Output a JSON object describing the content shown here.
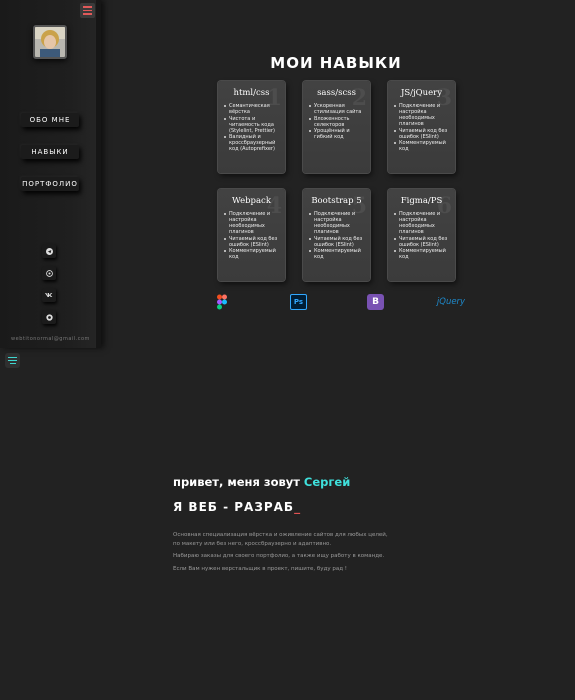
{
  "sidebar": {
    "nav": [
      "ОБО МНЕ",
      "НАВЫКИ",
      "ПОРТФОЛИО"
    ],
    "social_icons": [
      "telegram-icon",
      "whatsapp-icon",
      "vk-icon",
      "github-icon"
    ],
    "email": "webtitonormal@gmail.com"
  },
  "skills": {
    "title": "МОИ НАВЫКИ",
    "cards": [
      {
        "title": "html/css",
        "num": "1",
        "items": [
          "Семантическая вёрстка",
          "Чистота и читаемость кода (Stylelint, Prettier)",
          "Валидный и кроссбраузерный код (Autoprefixer)"
        ]
      },
      {
        "title": "sass/scss",
        "num": "2",
        "items": [
          "Ускоренная стилизация сайта",
          "Вложенность селекторов",
          "Урощённый и гибкий код"
        ]
      },
      {
        "title": "JS/jQuery",
        "num": "3",
        "items": [
          "Подключение и настройка необходимых плагинов",
          "Читаемый код без ошибок (ESlint)",
          "Комментируемый код"
        ]
      },
      {
        "title": "Webpack",
        "num": "4",
        "items": [
          "Подключение и настройка необходимых плагинов",
          "Читаемый код без ошибок (ESlint)",
          "Комментируемый код"
        ]
      },
      {
        "title": "Bootstrap 5",
        "num": "5",
        "items": [
          "Подключение и настройка необходимых плагинов",
          "Читаемый код без ошибок (ESlint)",
          "Комментируемый код"
        ]
      },
      {
        "title": "Figma/PS",
        "num": "6",
        "items": [
          "Подключение и настройка необходимых плагинов",
          "Читаемый код без ошибок (ESlint)",
          "Комментируемый код"
        ]
      }
    ],
    "logos": {
      "ps": "Ps",
      "bootstrap": "B",
      "jquery": "jQuery"
    }
  },
  "hero": {
    "greeting": "привет, меня зовут ",
    "name": "Сергей",
    "headline": "Я ВЕБ - РАЗРАБ",
    "cursor": "_",
    "p1_line1": "Основная специализация вёрстка и оживление сайтов для любых целей,",
    "p1_line2": "по макету или без него, кроссбраузерно и адаптивно.",
    "p2": "Набираю заказы для своего портфолио, а также ищу работу в команде.",
    "p3": "Если Вам нужен верстальщик в проект, пишите, буду рад !"
  },
  "colors": {
    "accent": "#3fe0dc",
    "cursor": "#e05252",
    "background": "#222222"
  }
}
